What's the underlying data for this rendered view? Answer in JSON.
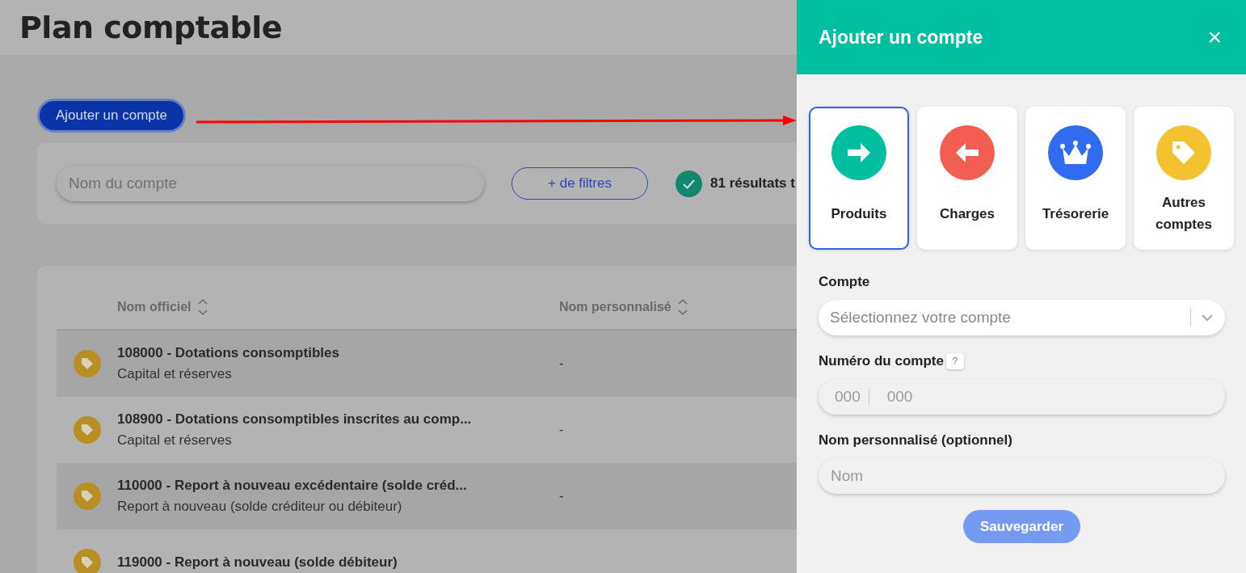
{
  "page": {
    "title": "Plan comptable",
    "add_button": "Ajouter un compte",
    "search": {
      "placeholder": "Nom du compte"
    },
    "filters_button": "+ de filtres",
    "results": "81 résultats t"
  },
  "table": {
    "columns": [
      "Nom officiel",
      "Nom personnalisé"
    ],
    "rows": [
      {
        "name": "108000 - Dotations consomptibles",
        "category": "Capital et réserves",
        "custom": "-"
      },
      {
        "name": "108900 - Dotations consomptibles inscrites au comp...",
        "category": "Capital et réserves",
        "custom": "-"
      },
      {
        "name": "110000 - Report à nouveau excédentaire (solde créd...",
        "category": "Report à nouveau (solde créditeur ou débiteur)",
        "custom": "-"
      },
      {
        "name": "119000 - Report à nouveau (solde débiteur)",
        "category": "",
        "custom": ""
      }
    ]
  },
  "drawer": {
    "title": "Ajouter un compte",
    "close": "×",
    "types": [
      {
        "kind": "arrow-right",
        "label": "Produits",
        "color": "#00bfa0",
        "selected": true
      },
      {
        "kind": "arrow-left",
        "label": "Charges",
        "color": "#f25f52",
        "selected": false
      },
      {
        "kind": "crown",
        "label": "Trésorerie",
        "color": "#316bf0",
        "selected": false
      },
      {
        "kind": "tag",
        "label": "Autres comptes",
        "color": "#f4c22e",
        "selected": false
      }
    ],
    "account_label": "Compte",
    "account_select": {
      "placeholder": "Sélectionnez votre compte"
    },
    "number_label": "Numéro du compte",
    "help": "?",
    "number_field": {
      "placeholder_1": "000",
      "placeholder_2": "000"
    },
    "custom_label": "Nom personnalisé (optionnel)",
    "custom_field": {
      "placeholder": "Nom"
    },
    "save": "Sauvegarder"
  }
}
